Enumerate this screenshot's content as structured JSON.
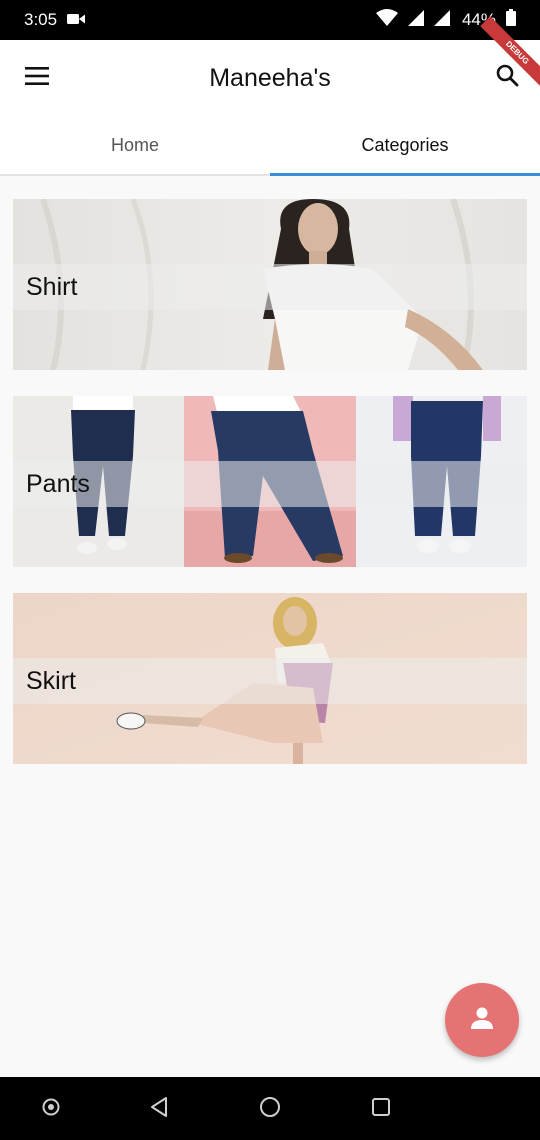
{
  "status_bar": {
    "time": "3:05",
    "battery": "44%"
  },
  "app_bar": {
    "title": "Maneeha's",
    "debug_banner": "DEBUG"
  },
  "tabs": [
    {
      "label": "Home",
      "active": false
    },
    {
      "label": "Categories",
      "active": true
    }
  ],
  "categories": [
    {
      "label": "Shirt"
    },
    {
      "label": "Pants"
    },
    {
      "label": "Skirt"
    }
  ],
  "colors": {
    "accent": "#3a8fd9",
    "fab": "#e57373"
  },
  "icons": {
    "menu": "menu-icon",
    "search": "search-icon",
    "fab": "person-icon"
  }
}
